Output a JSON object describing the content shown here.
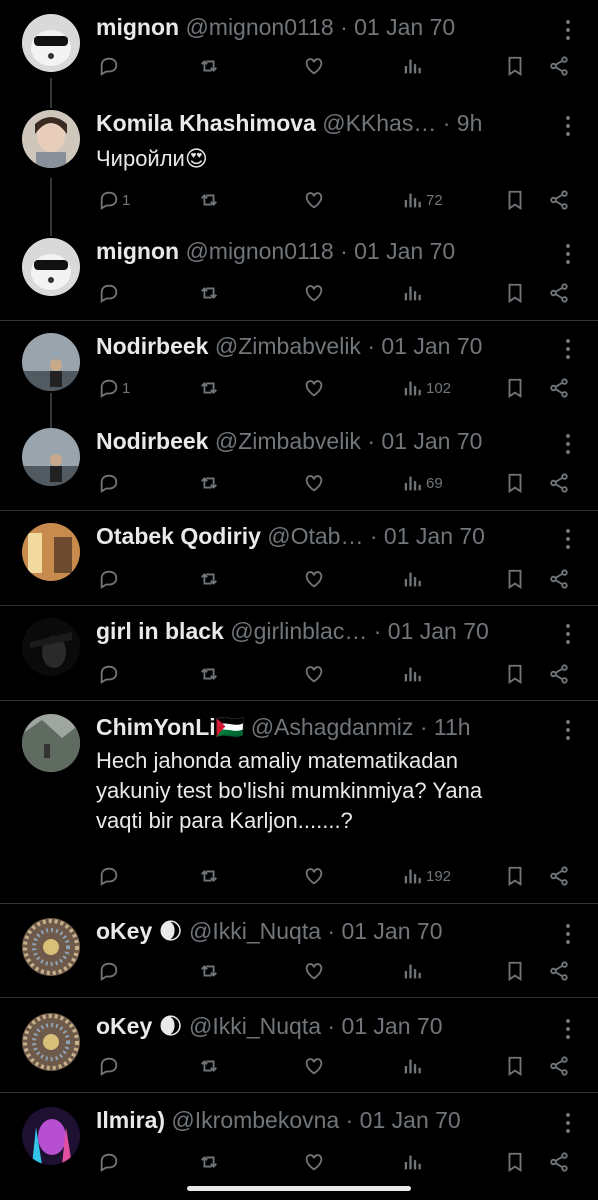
{
  "tweets": [
    {
      "name": "mignon",
      "handle": "@mignon0118",
      "time": "· 01 Jan 70",
      "text": "",
      "replies": "",
      "views": ""
    },
    {
      "name": "Komila Khashimova",
      "handle": "@KKhas…",
      "time": "· 9h",
      "text": "Чиройли😍",
      "replies": "1",
      "views": "72"
    },
    {
      "name": "mignon",
      "handle": "@mignon0118",
      "time": "· 01 Jan 70",
      "text": "",
      "replies": "",
      "views": ""
    },
    {
      "name": "Nodirbeek",
      "handle": "@Zimbabvelik",
      "time": "· 01 Jan 70",
      "text": "",
      "replies": "1",
      "views": "102"
    },
    {
      "name": "Nodirbeek",
      "handle": "@Zimbabvelik",
      "time": "· 01 Jan 70",
      "text": "",
      "replies": "",
      "views": "69"
    },
    {
      "name": "Otabek Qodiriy",
      "handle": "@Otab…",
      "time": "· 01 Jan 70",
      "text": "",
      "replies": "",
      "views": ""
    },
    {
      "name": "girl in black",
      "handle": "@girlinblac…",
      "time": "· 01 Jan 70",
      "text": "",
      "replies": "",
      "views": ""
    },
    {
      "name": "ChimYonLi🇵🇸",
      "handle": "@Ashagdanmiz",
      "time": "· 11h",
      "text": "Hech jahonda amaliy matematikadan\nyakuniy test bo'lishi mumkinmiya? Yana\nvaqti bir para Karljon.......?",
      "replies": "",
      "views": "192"
    },
    {
      "name": "oKey 🌒",
      "handle": "@Ikki_Nuqta",
      "time": "· 01 Jan 70",
      "text": "",
      "replies": "",
      "views": ""
    },
    {
      "name": "oKey 🌒",
      "handle": "@Ikki_Nuqta",
      "time": "· 01 Jan 70",
      "text": "",
      "replies": "",
      "views": ""
    },
    {
      "name": "Ilmira)",
      "handle": "@Ikrombekovna",
      "time": "· 01 Jan 70",
      "text": "",
      "replies": "",
      "views": ""
    }
  ],
  "icons": {
    "reply": "reply-icon",
    "retweet": "retweet-icon",
    "like": "like-icon",
    "views": "views-icon",
    "bookmark": "bookmark-icon",
    "share": "share-icon",
    "more": "more-icon"
  },
  "colors": {
    "background": "#000000",
    "text": "#e7e9ea",
    "muted": "#71767b",
    "divider": "#2f3336"
  }
}
